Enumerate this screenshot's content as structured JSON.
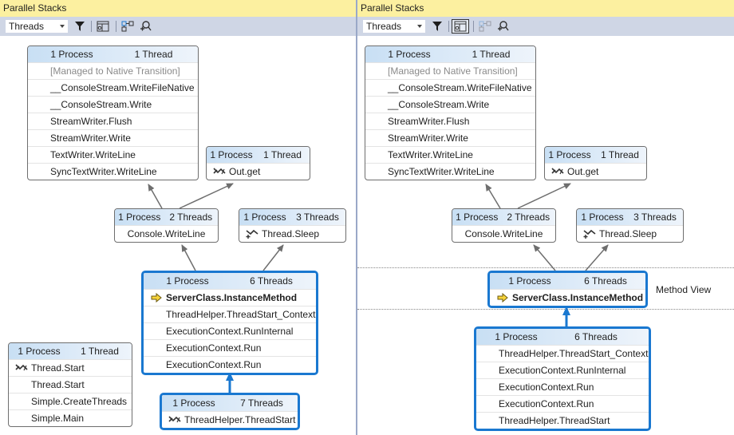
{
  "panes": [
    {
      "title": "Parallel Stacks",
      "toolbar": {
        "view_select": "Threads",
        "buttons": [
          {
            "name": "filter-icon",
            "state": "normal"
          },
          {
            "name": "toggle-method-view-icon",
            "state": "normal"
          },
          {
            "name": "auto-scroll-to-current-frame-icon",
            "state": "normal"
          },
          {
            "name": "toggle-zoom-control-icon",
            "state": "normal"
          }
        ]
      },
      "nodes": [
        {
          "id": "n1",
          "process": "1 Process",
          "threads": "1 Thread",
          "frames": [
            {
              "label": "[Managed to Native Transition]",
              "style": "muted"
            },
            {
              "label": "__ConsoleStream.WriteFileNative"
            },
            {
              "label": "__ConsoleStream.Write"
            },
            {
              "label": "StreamWriter.Flush"
            },
            {
              "label": "StreamWriter.Write"
            },
            {
              "label": "TextWriter.WriteLine"
            },
            {
              "label": "SyncTextWriter.WriteLine"
            }
          ]
        },
        {
          "id": "n2",
          "process": "1 Process",
          "threads": "1 Thread",
          "frames": [
            {
              "label": "Out.get",
              "icon": "thread-switch-icon"
            }
          ]
        },
        {
          "id": "n3",
          "process": "1 Process",
          "threads": "2 Threads",
          "frames": [
            {
              "label": "Console.WriteLine",
              "style": "center"
            }
          ]
        },
        {
          "id": "n4",
          "process": "1 Process",
          "threads": "3 Threads",
          "frames": [
            {
              "label": "Thread.Sleep",
              "icon": "thread-switch-plus-icon"
            }
          ]
        },
        {
          "id": "n5",
          "process": "1 Process",
          "threads": "6 Threads",
          "current": true,
          "frames": [
            {
              "label": "ServerClass.InstanceMethod",
              "style": "bold",
              "icon": "current-frame-arrow-icon"
            },
            {
              "label": "ThreadHelper.ThreadStart_Context"
            },
            {
              "label": "ExecutionContext.RunInternal"
            },
            {
              "label": "ExecutionContext.Run"
            },
            {
              "label": "ExecutionContext.Run"
            }
          ]
        },
        {
          "id": "n6",
          "process": "1 Process",
          "threads": "7 Threads",
          "current": true,
          "frames": [
            {
              "label": "ThreadHelper.ThreadStart",
              "icon": "thread-switch-icon"
            }
          ]
        },
        {
          "id": "n7",
          "process": "1 Process",
          "threads": "1 Thread",
          "frames": [
            {
              "label": "Thread.Start",
              "icon": "thread-switch-icon"
            },
            {
              "label": "Thread.Start"
            },
            {
              "label": "Simple.CreateThreads"
            },
            {
              "label": "Simple.Main"
            }
          ]
        }
      ]
    },
    {
      "title": "Parallel Stacks",
      "toolbar": {
        "view_select": "Threads",
        "buttons": [
          {
            "name": "filter-icon",
            "state": "normal"
          },
          {
            "name": "toggle-method-view-icon",
            "state": "active"
          },
          {
            "name": "auto-scroll-to-current-frame-icon",
            "state": "disabled"
          },
          {
            "name": "toggle-zoom-control-icon",
            "state": "normal"
          }
        ]
      },
      "method_view_label": "Method View",
      "nodes": [
        {
          "id": "m1",
          "process": "1 Process",
          "threads": "1 Thread",
          "frames": [
            {
              "label": "[Managed to Native Transition]",
              "style": "muted"
            },
            {
              "label": "__ConsoleStream.WriteFileNative"
            },
            {
              "label": "__ConsoleStream.Write"
            },
            {
              "label": "StreamWriter.Flush"
            },
            {
              "label": "StreamWriter.Write"
            },
            {
              "label": "TextWriter.WriteLine"
            },
            {
              "label": "SyncTextWriter.WriteLine"
            }
          ]
        },
        {
          "id": "m2",
          "process": "1 Process",
          "threads": "1 Thread",
          "frames": [
            {
              "label": "Out.get",
              "icon": "thread-switch-icon"
            }
          ]
        },
        {
          "id": "m3",
          "process": "1 Process",
          "threads": "2 Threads",
          "frames": [
            {
              "label": "Console.WriteLine",
              "style": "center"
            }
          ]
        },
        {
          "id": "m4",
          "process": "1 Process",
          "threads": "3 Threads",
          "frames": [
            {
              "label": "Thread.Sleep",
              "icon": "thread-switch-plus-icon"
            }
          ]
        },
        {
          "id": "m5",
          "process": "1 Process",
          "threads": "6 Threads",
          "current": true,
          "frames": [
            {
              "label": "ServerClass.InstanceMethod",
              "style": "bold",
              "icon": "current-frame-arrow-icon"
            }
          ]
        },
        {
          "id": "m6",
          "process": "1 Process",
          "threads": "6 Threads",
          "current": true,
          "frames": [
            {
              "label": "ThreadHelper.ThreadStart_Context"
            },
            {
              "label": "ExecutionContext.RunInternal"
            },
            {
              "label": "ExecutionContext.Run"
            },
            {
              "label": "ExecutionContext.Run"
            },
            {
              "label": "ThreadHelper.ThreadStart"
            }
          ]
        }
      ]
    }
  ]
}
